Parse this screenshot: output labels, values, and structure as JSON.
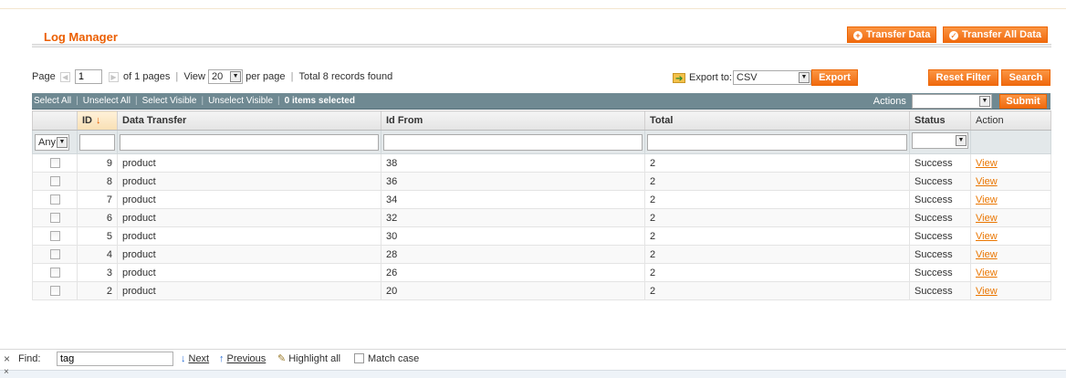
{
  "page": {
    "title": "Log Manager"
  },
  "header_buttons": {
    "transfer_data": "Transfer Data",
    "transfer_all_data": "Transfer All Data"
  },
  "pager": {
    "page_label": "Page",
    "page_value": "1",
    "of_pages": "of 1 pages",
    "view_label": "View",
    "per_page_value": "20",
    "per_page_label": "per page",
    "total": "Total 8 records found"
  },
  "export": {
    "label": "Export to:",
    "format": "CSV",
    "button": "Export"
  },
  "filter_buttons": {
    "reset": "Reset Filter",
    "search": "Search"
  },
  "massaction": {
    "select_all": "Select All",
    "unselect_all": "Unselect All",
    "select_visible": "Select Visible",
    "unselect_visible": "Unselect Visible",
    "selected_count": "0 items selected",
    "actions_label": "Actions",
    "actions_value": "",
    "submit": "Submit"
  },
  "grid": {
    "columns": {
      "id": "ID",
      "data_transfer": "Data Transfer",
      "id_from": "Id From",
      "total": "Total",
      "status": "Status",
      "action": "Action"
    },
    "filter_any": "Any",
    "rows": [
      {
        "id": "9",
        "data_transfer": "product",
        "id_from": "38",
        "total": "2",
        "status": "Success",
        "action": "View"
      },
      {
        "id": "8",
        "data_transfer": "product",
        "id_from": "36",
        "total": "2",
        "status": "Success",
        "action": "View"
      },
      {
        "id": "7",
        "data_transfer": "product",
        "id_from": "34",
        "total": "2",
        "status": "Success",
        "action": "View"
      },
      {
        "id": "6",
        "data_transfer": "product",
        "id_from": "32",
        "total": "2",
        "status": "Success",
        "action": "View"
      },
      {
        "id": "5",
        "data_transfer": "product",
        "id_from": "30",
        "total": "2",
        "status": "Success",
        "action": "View"
      },
      {
        "id": "4",
        "data_transfer": "product",
        "id_from": "28",
        "total": "2",
        "status": "Success",
        "action": "View"
      },
      {
        "id": "3",
        "data_transfer": "product",
        "id_from": "26",
        "total": "2",
        "status": "Success",
        "action": "View"
      },
      {
        "id": "2",
        "data_transfer": "product",
        "id_from": "20",
        "total": "2",
        "status": "Success",
        "action": "View"
      }
    ]
  },
  "findbar": {
    "find_label": "Find:",
    "query": "tag",
    "next": "Next",
    "previous": "Previous",
    "highlight_all": "Highlight all",
    "match_case": "Match case"
  },
  "colors": {
    "accent": "#eb5e00",
    "button": "#f06a0f",
    "massbar": "#6f8992",
    "link": "#ea7601"
  },
  "icons": {
    "transfer": "plus-circle-icon",
    "transfer_all": "check-circle-icon",
    "export": "export-icon",
    "sort": "arrow-down-icon",
    "find_next": "arrow-down-icon",
    "find_prev": "arrow-up-icon",
    "highlight": "highlighter-icon"
  }
}
